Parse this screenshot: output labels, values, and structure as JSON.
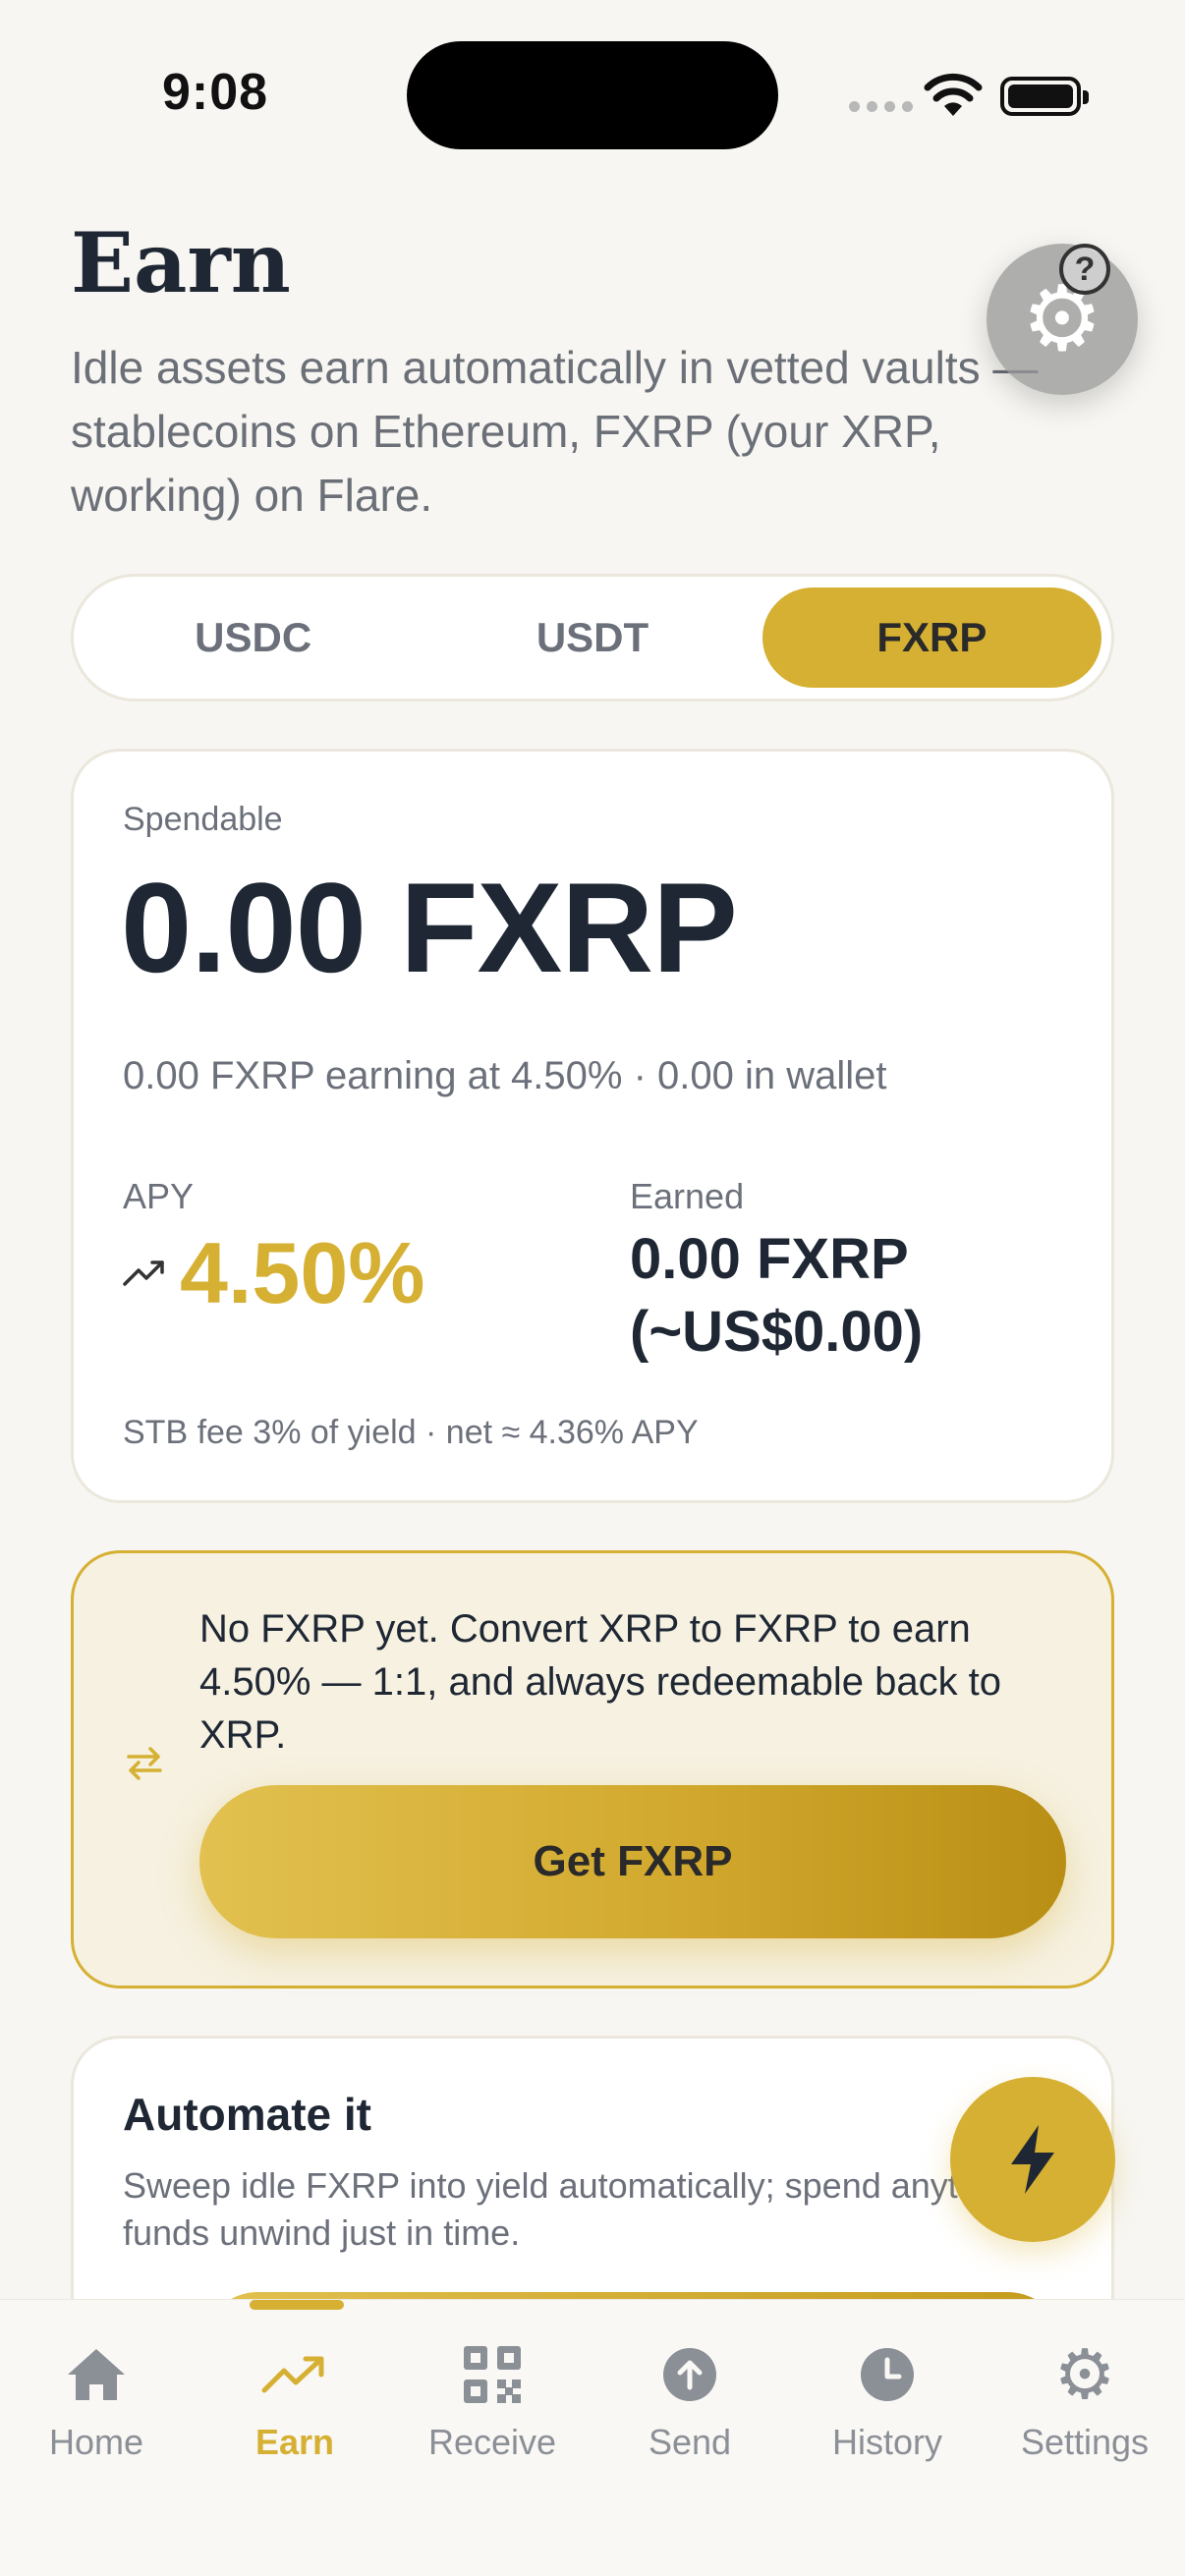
{
  "status_bar": {
    "time": "9:08"
  },
  "header": {
    "title": "Earn",
    "subtitle": "Idle assets earn automatically in vetted vaults — stablecoins on Ethereum, FXRP (your XRP, working) on Flare.",
    "help_icon": "gear-question-icon"
  },
  "segments": [
    {
      "label": "USDC",
      "active": false
    },
    {
      "label": "USDT",
      "active": false
    },
    {
      "label": "FXRP",
      "active": true
    }
  ],
  "balance": {
    "label": "Spendable",
    "amount": "0.00 FXRP",
    "summary": "0.00 FXRP earning at 4.50% · 0.00 in wallet",
    "apy_label": "APY",
    "apy_value": "4.50%",
    "earned_label": "Earned",
    "earned_value": "0.00 FXRP (~US$0.00)",
    "fee_note": "STB fee 3% of yield · net ≈ 4.36% APY"
  },
  "cta": {
    "text": "No FXRP yet. Convert XRP to FXRP to earn 4.50% — 1:1, and always redeemable back to XRP.",
    "button": "Get FXRP"
  },
  "automate": {
    "title": "Automate it",
    "description": "Sweep idle FXRP into yield automatically; spend anytime — funds unwind just in time."
  },
  "tabs": [
    {
      "label": "Home",
      "icon": "home-icon",
      "active": false
    },
    {
      "label": "Earn",
      "icon": "trend-icon",
      "active": true
    },
    {
      "label": "Receive",
      "icon": "qr-icon",
      "active": false
    },
    {
      "label": "Send",
      "icon": "send-icon",
      "active": false
    },
    {
      "label": "History",
      "icon": "clock-icon",
      "active": false
    },
    {
      "label": "Settings",
      "icon": "gear-icon",
      "active": false
    }
  ],
  "colors": {
    "accent": "#d6b032",
    "text": "#1e2733",
    "muted": "#6b707a",
    "background": "#f7f6f2"
  }
}
